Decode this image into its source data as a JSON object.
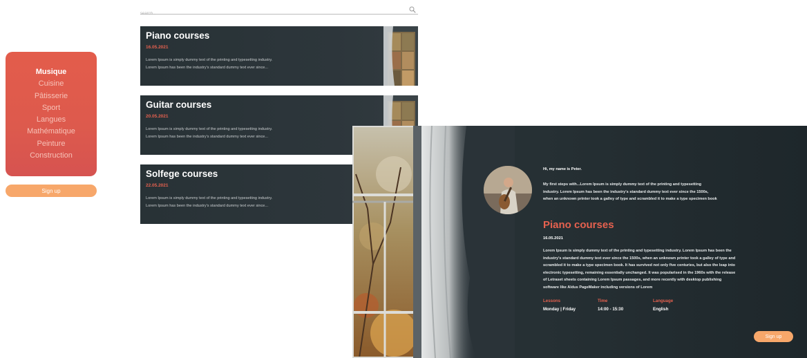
{
  "sidebar": {
    "items": [
      {
        "label": "Musique"
      },
      {
        "label": "Cuisine"
      },
      {
        "label": "Pâtisserie"
      },
      {
        "label": "Sport"
      },
      {
        "label": "Langues"
      },
      {
        "label": "Mathématique"
      },
      {
        "label": "Peinture"
      },
      {
        "label": "Construction"
      }
    ],
    "active": "Musique",
    "signup_label": "Sign up"
  },
  "search": {
    "placeholder": "search...",
    "icon": "search-icon"
  },
  "courses": [
    {
      "title": "Piano courses",
      "date": "16.05.2021",
      "description": "Lorem Ipsum is simply dummy text of the printing and typesetting industry. Lorem Ipsum has been the industry's standard dummy text ever since..."
    },
    {
      "title": "Guitar courses",
      "date": "20.05.2021",
      "description": "Lorem Ipsum is simply dummy text of the printing and typesetting industry. Lorem Ipsum has been the industry's standard dummy text ever since..."
    },
    {
      "title": "Solfege courses",
      "date": "22.05.2021",
      "description": "Lorem Ipsum is simply dummy text of the printing and typesetting industry. Lorem Ipsum has been the industry's standard dummy text ever since..."
    }
  ],
  "detail": {
    "greeting": "Hi, my name is Peter.",
    "intro": "My first steps with...Lorem Ipsum is simply dummy text of the printing and typesetting industry. Lorem Ipsum has been the industry's standard dummy text ever since the 1500s, when an unknown printer took a galley of type and scrambled it to make a type specimen book",
    "title": "Piano courses",
    "date": "16.05.2021",
    "body": "Lorem Ipsum is simply dummy text of the printing and typesetting industry. Lorem Ipsum has been the industry's standard dummy text ever since the 1500s, when an unknown printer took a galley of type and scrambled it to make a type specimen book. It has survived not only five centuries, but also the leap into electronic typesetting, remaining essentially unchanged. It was popularised in the 1960s with the release of Letraset sheets containing Lorem Ipsum passages, and more recently with desktop publishing software like Aldus PageMaker including versions of Lorem",
    "info": [
      {
        "label": "Lessons",
        "value": "Monday | Friday"
      },
      {
        "label": "Time",
        "value": "14:00 - 15:30"
      },
      {
        "label": "Language",
        "value": "English"
      }
    ],
    "signup_label": "Sign up"
  },
  "colors": {
    "accent": "#e6614f",
    "button": "#f7a76a",
    "card_bg": "#2b3439",
    "sidebar_bg": "#e05b4c"
  }
}
